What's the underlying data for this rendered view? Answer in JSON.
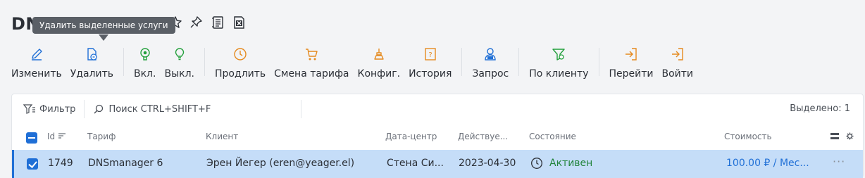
{
  "page": {
    "title": "DNS"
  },
  "tooltip": {
    "text": "Удалить выделенные услуги"
  },
  "title_icons": [
    "star-icon",
    "pin-icon",
    "document-icon",
    "excel-icon"
  ],
  "toolbar": {
    "edit": "Изменить",
    "delete": "Удалить",
    "enable": "Вкл.",
    "disable": "Выкл.",
    "renew": "Продлить",
    "change_tariff": "Смена тарифа",
    "config": "Конфиг.",
    "history": "История",
    "request": "Запрос",
    "by_client": "По клиенту",
    "go": "Перейти",
    "login": "Войти"
  },
  "filter_bar": {
    "filter_label": "Фильтр",
    "search_placeholder": "Поиск CTRL+SHIFT+F",
    "selected_text": "Выделено: 1"
  },
  "table": {
    "columns": [
      "Id",
      "Тариф",
      "Клиент",
      "Дата-центр",
      "Действуе...",
      "Состояние",
      "Стоимость"
    ],
    "rows": [
      {
        "id": "1749",
        "tariff": "DNSmanager 6",
        "client": "Эрен Йегер (eren@yeager.el)",
        "datacenter": "Стена Си...",
        "expires": "2023-04-30",
        "status": "Активен",
        "price": "100.00 ₽ / Мес...",
        "more": "···"
      }
    ]
  },
  "colors": {
    "accent": "#1f6fd6",
    "green": "#23a03c",
    "orange": "#e58a1f",
    "selected_row": "#c5ddf8",
    "status_active": "#23843c"
  }
}
